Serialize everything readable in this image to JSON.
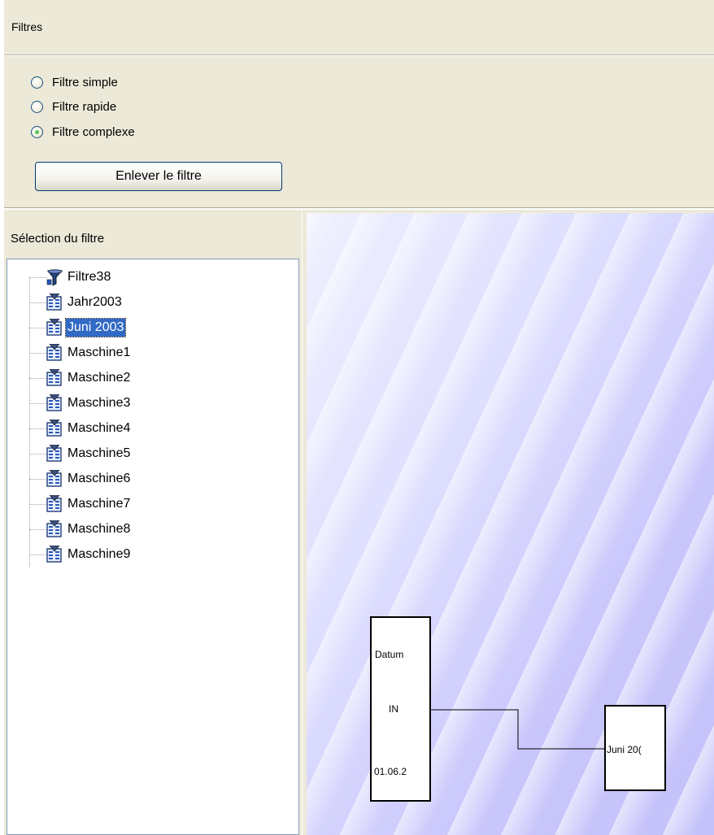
{
  "header": {
    "title": "Filtres"
  },
  "filter_mode": {
    "options": [
      {
        "label": "Filtre simple",
        "checked": false
      },
      {
        "label": "Filtre rapide",
        "checked": false
      },
      {
        "label": "Filtre complexe",
        "checked": true
      }
    ]
  },
  "remove_button": {
    "label": "Enlever le filtre"
  },
  "selection_panel": {
    "title": "Sélection du filtre"
  },
  "tree": {
    "items": [
      {
        "label": "Filtre38",
        "icon": "filter-icon",
        "selected": false
      },
      {
        "label": "Jahr2003",
        "icon": "filter-document-icon",
        "selected": false
      },
      {
        "label": "Juni 2003",
        "icon": "filter-document-icon",
        "selected": true
      },
      {
        "label": "Maschine1",
        "icon": "filter-document-icon",
        "selected": false
      },
      {
        "label": "Maschine2",
        "icon": "filter-document-icon",
        "selected": false
      },
      {
        "label": "Maschine3",
        "icon": "filter-document-icon",
        "selected": false
      },
      {
        "label": "Maschine4",
        "icon": "filter-document-icon",
        "selected": false
      },
      {
        "label": "Maschine5",
        "icon": "filter-document-icon",
        "selected": false
      },
      {
        "label": "Maschine6",
        "icon": "filter-document-icon",
        "selected": false
      },
      {
        "label": "Maschine7",
        "icon": "filter-document-icon",
        "selected": false
      },
      {
        "label": "Maschine8",
        "icon": "filter-document-icon",
        "selected": false
      },
      {
        "label": "Maschine9",
        "icon": "filter-document-icon",
        "selected": false
      }
    ]
  },
  "diagram": {
    "condition_node": {
      "field": "Datum",
      "operator": "IN",
      "value": "01.06.2"
    },
    "target_node": {
      "label": "Juni 20("
    }
  },
  "colors": {
    "selection": "#316ac5",
    "panel": "#ece9d8",
    "tree_border": "#7f9db9"
  }
}
